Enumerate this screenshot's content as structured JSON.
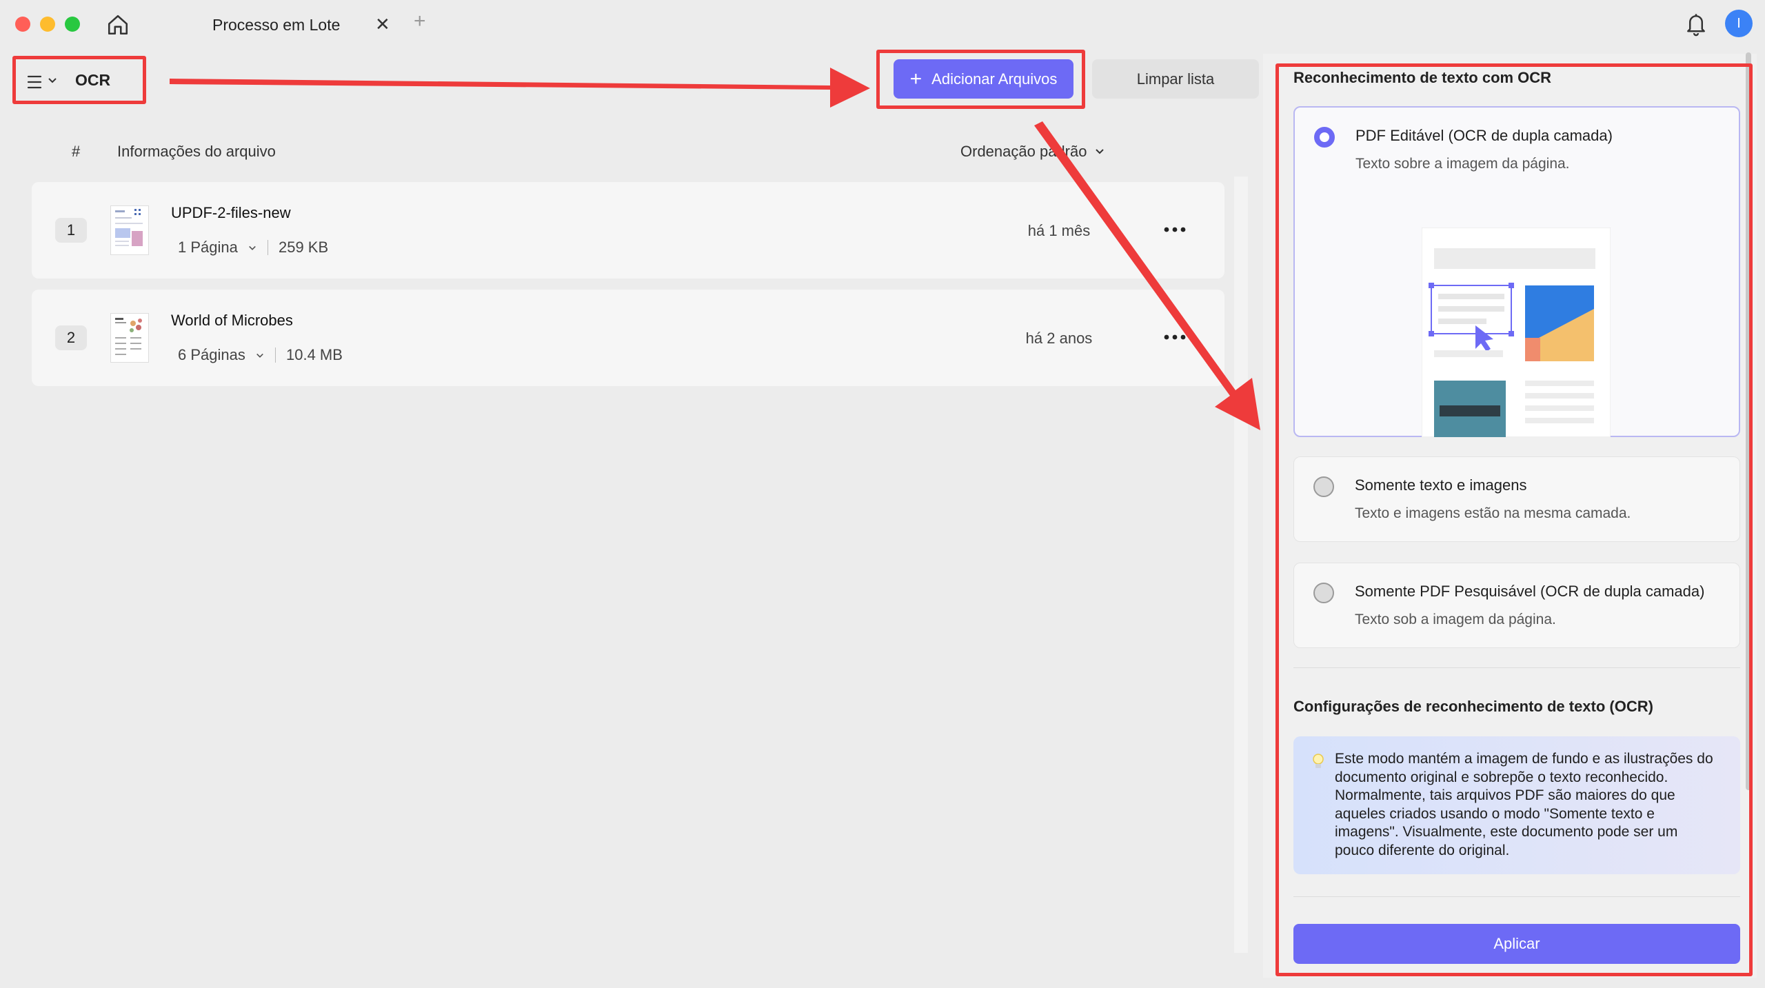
{
  "window": {
    "tab_title": "Processo em Lote",
    "tab_close": "✕",
    "tab_add": "+",
    "avatar_letter": "I"
  },
  "toolbar": {
    "mode_label": "OCR",
    "add_files_label": "Adicionar Arquivos",
    "add_files_icon": "+",
    "clear_list_label": "Limpar lista"
  },
  "file_list": {
    "col_index": "#",
    "col_info": "Informações do arquivo",
    "sort_label": "Ordenação padrão",
    "files": [
      {
        "index": "1",
        "name": "UPDF-2-files-new",
        "pages": "1 Página",
        "size": "259 KB",
        "date": "há 1 mês"
      },
      {
        "index": "2",
        "name": "World of Microbes",
        "pages": "6 Páginas",
        "size": "10.4 MB",
        "date": "há 2 anos"
      }
    ]
  },
  "ocr_panel": {
    "title": "Reconhecimento de texto com OCR",
    "options": [
      {
        "title": "PDF Editável (OCR de dupla camada)",
        "desc": "Texto sobre a imagem da página.",
        "selected": true
      },
      {
        "title": "Somente texto e imagens",
        "desc": "Texto e imagens estão na mesma camada.",
        "selected": false
      },
      {
        "title": "Somente PDF Pesquisável (OCR de dupla camada)",
        "desc": "Texto sob a imagem da página.",
        "selected": false
      }
    ],
    "settings_title": "Configurações de reconhecimento de texto (OCR)",
    "tip_text": "Este modo mantém a imagem de fundo e as ilustrações do documento original e sobrepõe o texto reconhecido. Normalmente, tais arquivos PDF são maiores do que aqueles criados usando o modo \"Somente texto e imagens\". Visualmente, este documento pode ser um pouco diferente do original.",
    "apply_label": "Aplicar"
  },
  "colors": {
    "accent": "#6d6af5",
    "highlight": "#ee3b3b"
  }
}
